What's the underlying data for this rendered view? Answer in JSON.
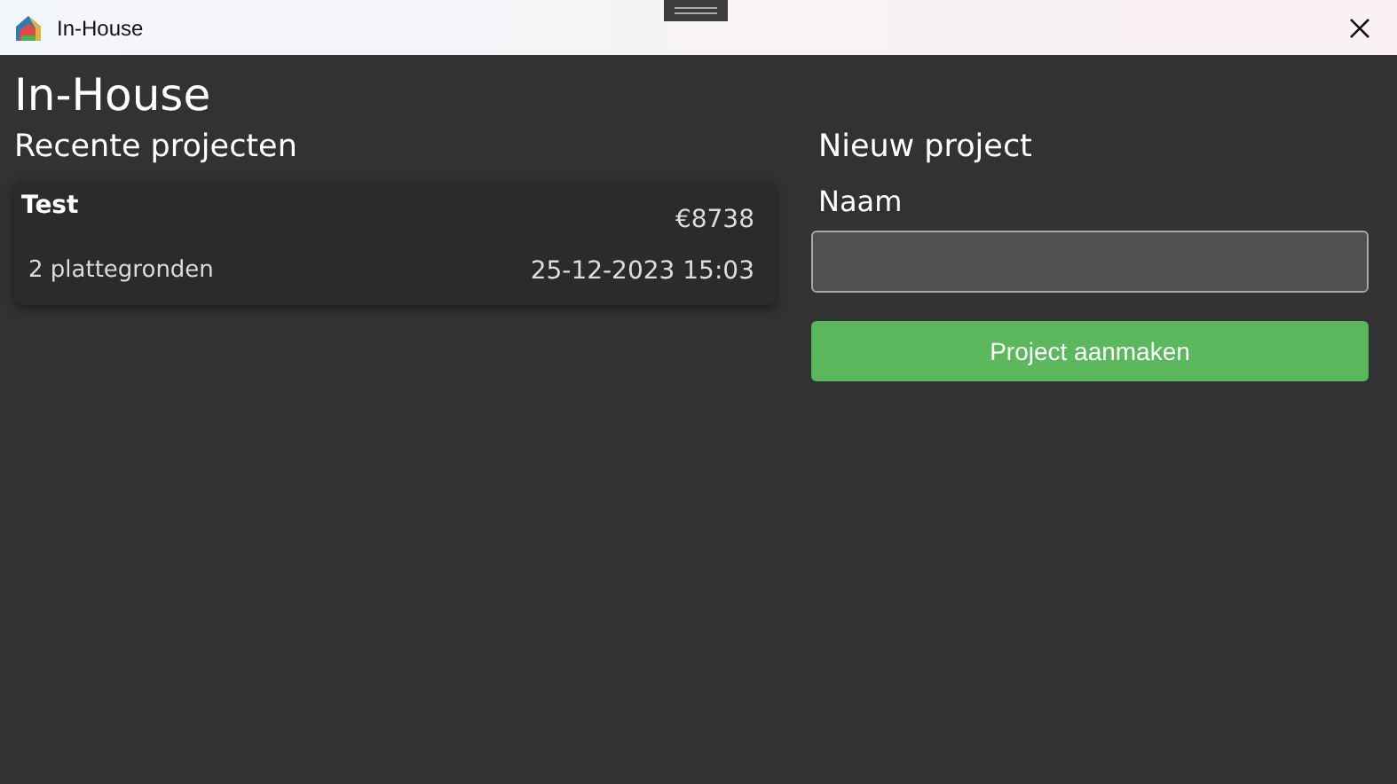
{
  "window": {
    "title": "In-House"
  },
  "app_title": "In-House",
  "recent": {
    "heading": "Recente projecten",
    "projects": [
      {
        "name": "Test",
        "price": "€8738",
        "floorplans": "2 plattegronden",
        "date": "25-12-2023 15:03"
      }
    ]
  },
  "new_project": {
    "heading": "Nieuw project",
    "name_label": "Naam",
    "button": "Project aanmaken"
  }
}
